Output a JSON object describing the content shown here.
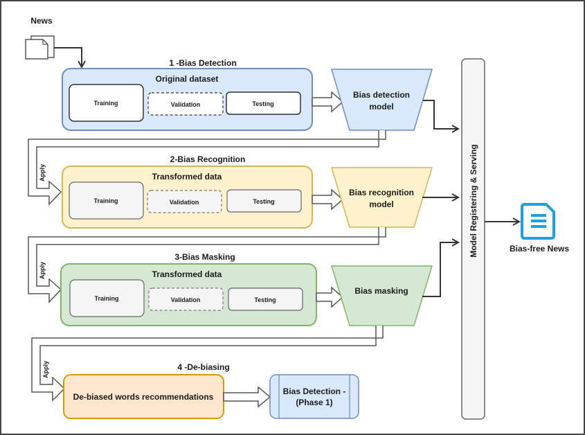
{
  "input": {
    "label": "News",
    "icon": "documents-icon"
  },
  "stages": [
    {
      "title": "1 -Bias Detection",
      "dataset": "Original dataset",
      "splits": [
        "Training",
        "Validation",
        "Testing"
      ],
      "model": [
        "Bias detection",
        "model"
      ],
      "color": "#dae8fc",
      "stroke": "#6c8ebf"
    },
    {
      "title": "2-Bias Recognition",
      "dataset": "Transformed data",
      "splits": [
        "Training",
        "Validation",
        "Testing"
      ],
      "model": [
        "Bias recognition",
        "model"
      ],
      "color": "#fff2cc",
      "stroke": "#d6b656"
    },
    {
      "title": "3-Bias Masking",
      "dataset": "Transformed data",
      "splits": [
        "Training",
        "Validation",
        "Testing"
      ],
      "model": [
        "Bias masking"
      ],
      "color": "#d5e8d4",
      "stroke": "#82b366"
    },
    {
      "title": "4 -De-biasing",
      "box": "De-biased words recommendations",
      "next": [
        "Bias Detection -",
        "(Phase 1)"
      ],
      "color": "#ffe6cc",
      "stroke": "#d79b00"
    }
  ],
  "connector_label": "Apply",
  "serving": {
    "label": "Model Registering & Serving"
  },
  "output": {
    "label": "Bias-free News",
    "icon": "document-icon",
    "color": "#1ba1e2"
  }
}
